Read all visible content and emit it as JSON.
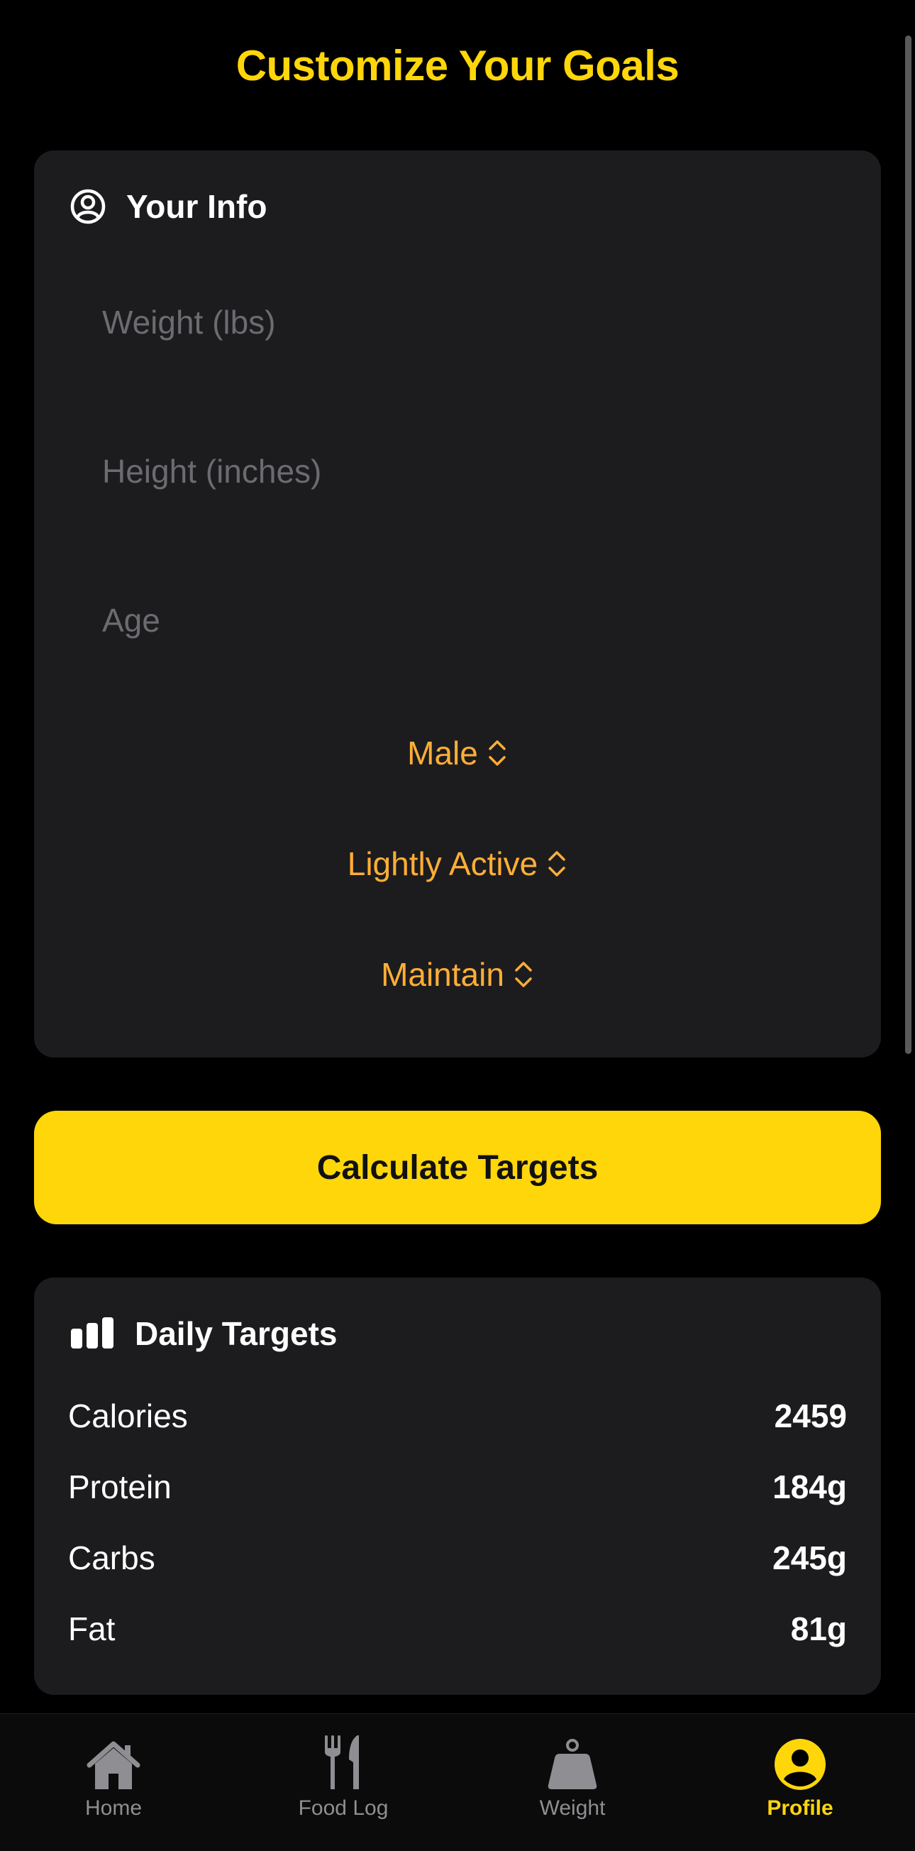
{
  "header": {
    "title": "Customize Your Goals"
  },
  "info_card": {
    "title": "Your Info",
    "icon": "person-circle-icon",
    "fields": {
      "weight_placeholder": "Weight (lbs)",
      "height_placeholder": "Height (inches)",
      "age_placeholder": "Age"
    },
    "pickers": {
      "sex": "Male",
      "activity": "Lightly Active",
      "goal": "Maintain"
    }
  },
  "calculate_button": {
    "label": "Calculate Targets"
  },
  "targets_card": {
    "title": "Daily Targets",
    "icon": "chart-bar-icon",
    "rows": [
      {
        "label": "Calories",
        "value": "2459"
      },
      {
        "label": "Protein",
        "value": "184g"
      },
      {
        "label": "Carbs",
        "value": "245g"
      },
      {
        "label": "Fat",
        "value": "81g"
      }
    ]
  },
  "tab_bar": {
    "active": "Profile",
    "tabs": [
      {
        "label": "Home",
        "icon": "house-icon"
      },
      {
        "label": "Food Log",
        "icon": "fork-knife-icon"
      },
      {
        "label": "Weight",
        "icon": "scale-weight-icon"
      },
      {
        "label": "Profile",
        "icon": "person-circle-icon"
      }
    ]
  },
  "colors": {
    "accent": "#FFD60A",
    "picker": "#FFAE36",
    "card": "#1C1C1E",
    "background": "#000000",
    "inactive_tab": "#8E8E93"
  }
}
